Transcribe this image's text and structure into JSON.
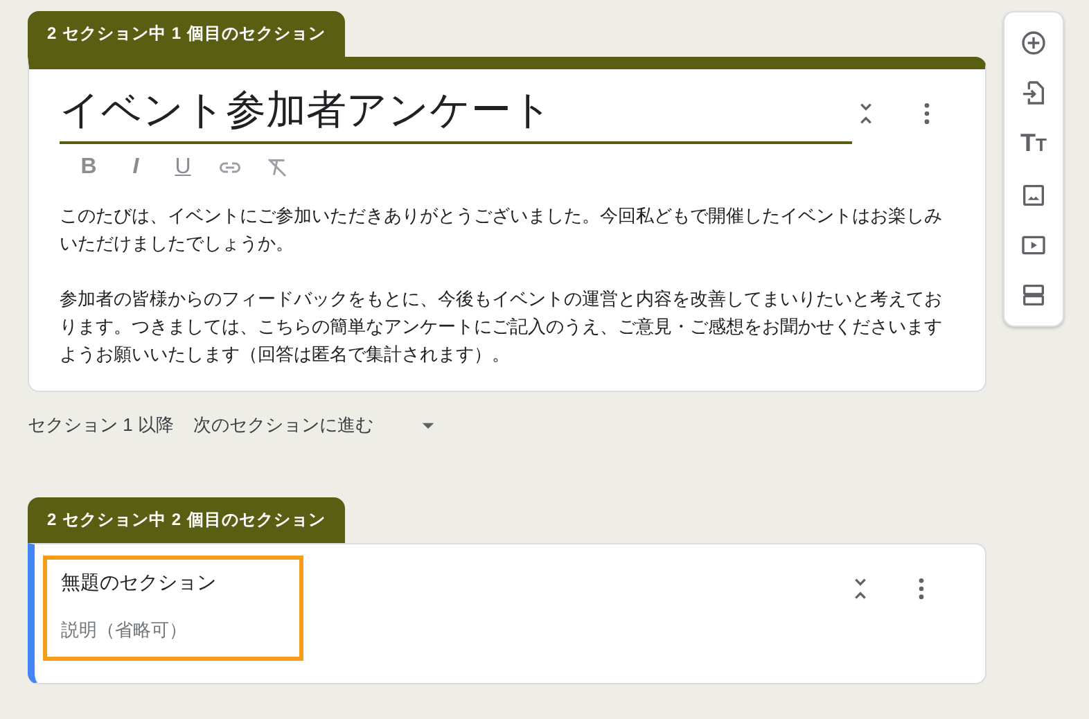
{
  "sections": [
    {
      "header": "2 セクション中 1 個目のセクション",
      "title": "イベント参加者アンケート",
      "editing": true,
      "selected": false,
      "highlighted": false,
      "format_buttons": [
        {
          "kind": "bold",
          "label": "B"
        },
        {
          "kind": "italic",
          "label": "I"
        },
        {
          "kind": "underline",
          "label": "U"
        },
        {
          "kind": "link"
        },
        {
          "kind": "clear"
        }
      ],
      "description": [
        "このたびは、イベントにご参加いただきありがとうございました。今回私どもで開催したイベントはお楽しみいただけましたでしょうか。",
        "参加者の皆様からのフィードバックをもとに、今後もイベントの運営と内容を改善してまいりたいと考えております。つきましては、こちらの簡単なアンケートにご記入のうえ、ご意見・ご感想をお聞かせくださいますようお願いいたします（回答は匿名で集計されます）。"
      ],
      "after_section": {
        "label": "セクション 1 以降",
        "value": "次のセクションに進む"
      }
    },
    {
      "header": "2 セクション中 2 個目のセクション",
      "title": "無題のセクション",
      "editing": false,
      "selected": true,
      "highlighted": true,
      "placeholder": "説明（省略可）"
    }
  ],
  "side_toolbar": [
    {
      "kind": "add"
    },
    {
      "kind": "import"
    },
    {
      "kind": "title",
      "label": "TT"
    },
    {
      "kind": "image"
    },
    {
      "kind": "video"
    },
    {
      "kind": "section"
    }
  ]
}
